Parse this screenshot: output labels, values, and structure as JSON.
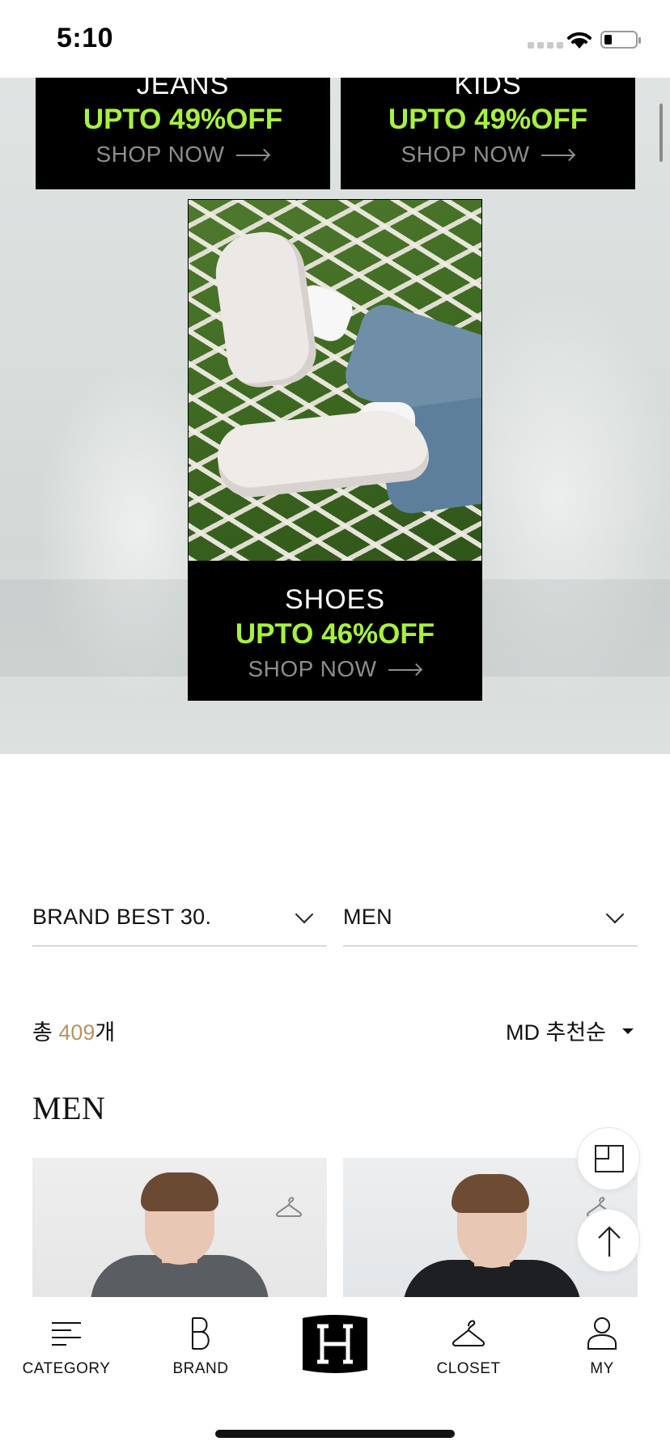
{
  "status_bar": {
    "time": "5:10"
  },
  "promos": {
    "jeans": {
      "title": "JEANS",
      "deal": "UPTO 49%OFF",
      "cta": "SHOP NOW"
    },
    "kids": {
      "title": "KIDS",
      "deal": "UPTO 49%OFF",
      "cta": "SHOP NOW"
    },
    "shoes": {
      "title": "SHOES",
      "deal": "UPTO 46%OFF",
      "cta": "SHOP NOW"
    }
  },
  "filters": {
    "brand_select": "BRAND BEST 30.",
    "gender_select": "MEN"
  },
  "results": {
    "count_prefix": "총 ",
    "count_value": "409",
    "count_suffix": "개",
    "sort_label": "MD 추천순"
  },
  "section": {
    "title": "MEN"
  },
  "tabbar": {
    "category": "CATEGORY",
    "brand": "BRAND",
    "closet": "CLOSET",
    "my": "MY"
  },
  "colors": {
    "accent_green": "#a6f23f",
    "count_gold": "#b89563"
  }
}
